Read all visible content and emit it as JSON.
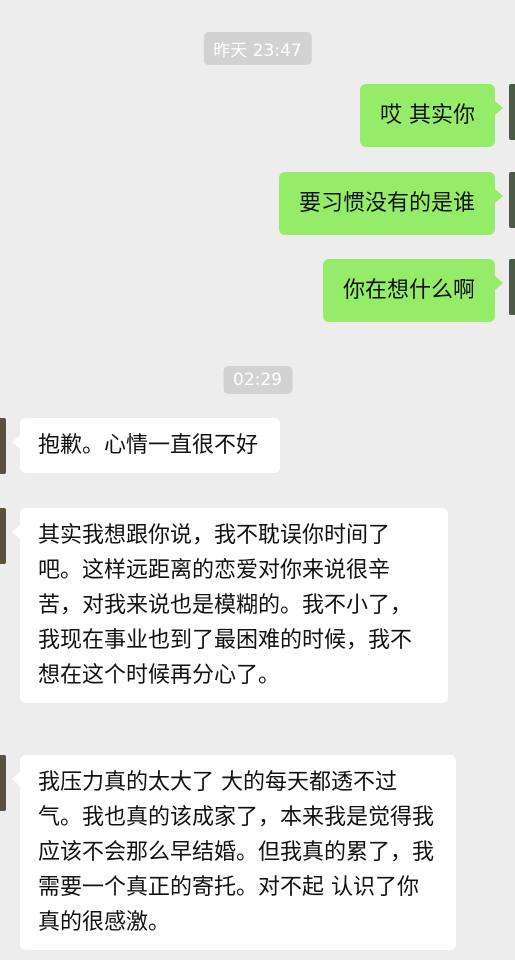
{
  "timestamps": [
    "昨天 23:47",
    "02:29"
  ],
  "outgoing": [
    "哎 其实你",
    "要习惯没有的是谁",
    "你在想什么啊"
  ],
  "incoming": [
    "抱歉。心情一直很不好",
    "其实我想跟你说，我不耽误你时间了吧。这样远距离的恋爱对你来说很辛苦，对我来说也是模糊的。我不小了，我现在事业也到了最困难的时候，我不想在这个时候再分心了。",
    "我压力真的太大了 大的每天都透不过气。我也真的该成家了，本来我是觉得我应该不会那么早结婚。但我真的累了，我需要一个真正的寄托。对不起 认识了你真的很感激。"
  ],
  "colors": {
    "background": "#ededed",
    "outgoing_bubble": "#95ec69",
    "incoming_bubble": "#ffffff",
    "timestamp_bg": "#d2d2d2"
  }
}
